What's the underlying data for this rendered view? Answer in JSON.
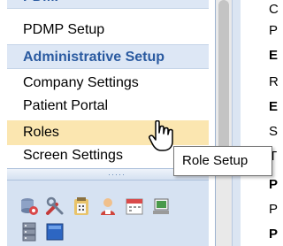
{
  "nav": {
    "cut_header_label": "PDMP",
    "items": [
      {
        "label": "PDMP Setup"
      },
      {
        "label": "Administrative Setup"
      },
      {
        "label": "Company Settings"
      },
      {
        "label": "Patient Portal"
      },
      {
        "label": "Roles"
      },
      {
        "label": "Screen Settings"
      }
    ],
    "grip_label": "·····",
    "tray_icons": [
      "database-settings-icon",
      "tools-icon",
      "clipboard-calculator-icon",
      "user-badge-icon",
      "calendar-icon",
      "monitor-icon",
      "server-icon",
      "blue-screen-icon"
    ]
  },
  "right_pane": {
    "line_initials": [
      "C",
      "P",
      "E",
      "R",
      "E",
      "S",
      "T",
      "P",
      "P",
      "P"
    ]
  },
  "tooltip": {
    "text": "Role Setup"
  },
  "colors": {
    "header_bg": "#dde7f5",
    "header_text": "#2a5aa0",
    "selected_bg": "#fbe6b0",
    "tray_bg": "#d6e2f2"
  }
}
